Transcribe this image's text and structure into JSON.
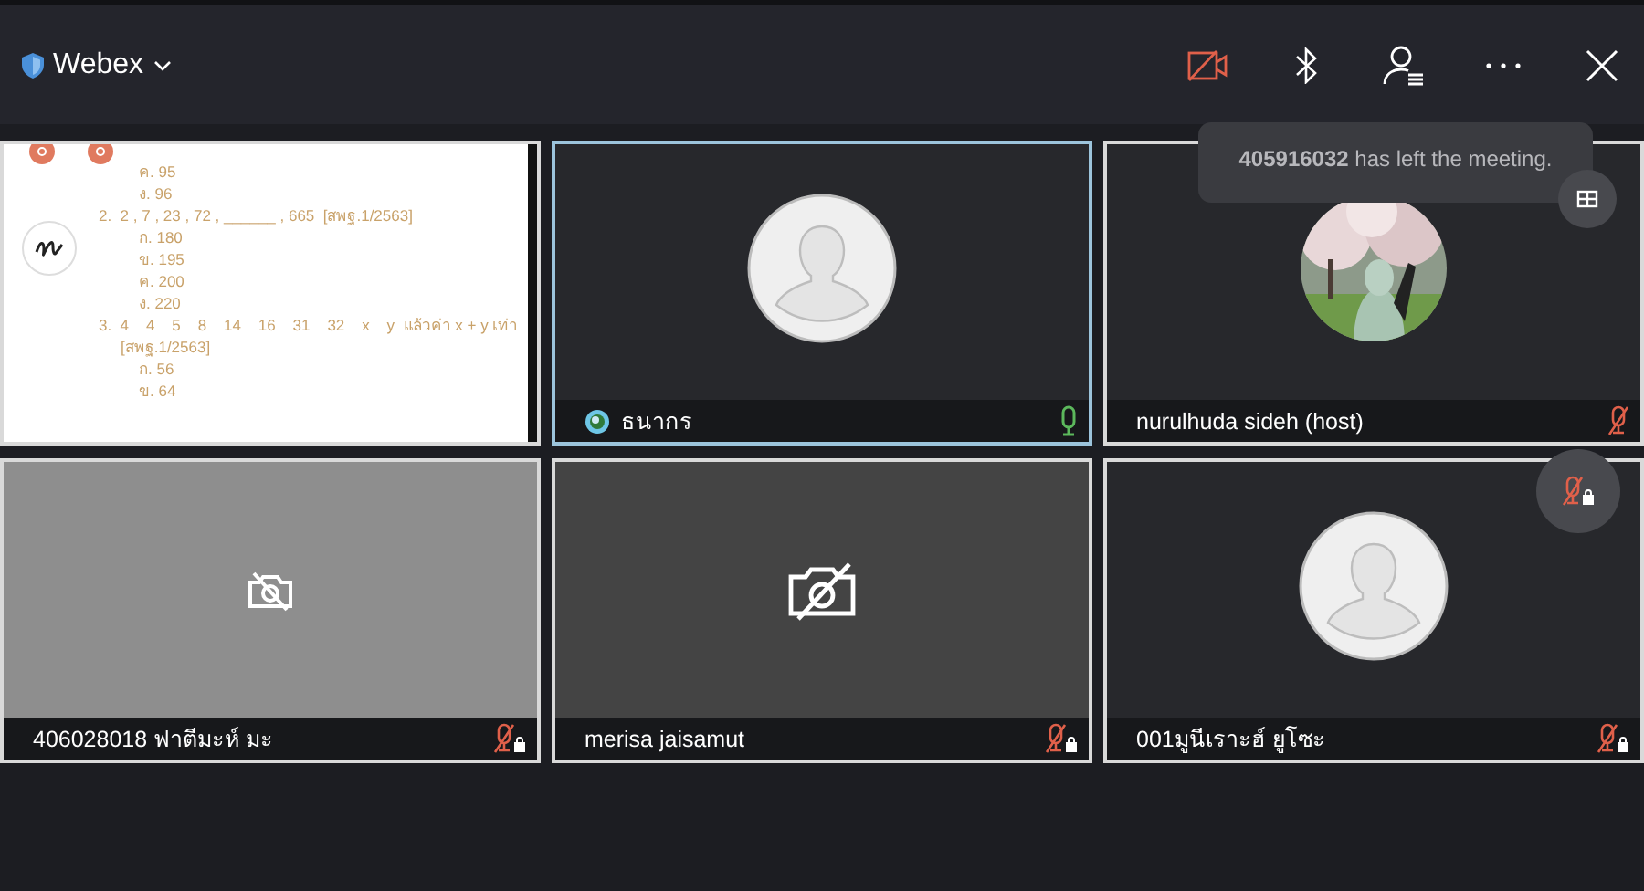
{
  "top_bar": {
    "app_name": "Webex",
    "camera_muted": true
  },
  "notification": {
    "text": "**405916032** has left the meeting."
  },
  "shared_content": {
    "lines": [
      {
        "kind": "option",
        "text": "ค. 95"
      },
      {
        "kind": "option",
        "text": "ง. 96"
      },
      {
        "kind": "question",
        "text": "2.  2 , 7 , 23 , 72 , ______ , 665  [สพฐ.1/2563]"
      },
      {
        "kind": "option",
        "text": "ก. 180"
      },
      {
        "kind": "option",
        "text": "ข. 195"
      },
      {
        "kind": "option",
        "text": "ค. 200"
      },
      {
        "kind": "option",
        "text": "ง. 220"
      },
      {
        "kind": "question",
        "text": "3.  4    4    5    8    14    16    31    32    x    y  แล้วค่า x + y เท่า"
      },
      {
        "kind": "source",
        "text": "[สพฐ.1/2563]"
      },
      {
        "kind": "option",
        "text": "ก. 56"
      },
      {
        "kind": "option",
        "text": "ข. 64"
      }
    ]
  },
  "tiles": [
    {
      "kind": "share",
      "selected": false
    },
    {
      "kind": "avatar",
      "name": "ธนากร",
      "muted": false,
      "locked": false,
      "selected": true,
      "status_dot": true
    },
    {
      "name": "nurulhuda sideh (host)",
      "muted": true,
      "locked": false,
      "selected": false,
      "status_dot": false
    },
    {
      "kind": "paused",
      "name": "406028018 ฟาตีมะห์ มะ",
      "muted": true,
      "locked": true,
      "selected": false,
      "status_dot": false
    },
    {
      "kind": "camera-off",
      "name": "merisa jaisamut",
      "muted": true,
      "locked": true,
      "selected": false,
      "status_dot": false
    },
    {
      "kind": "avatar",
      "name": "001มูนีเราะฮ์ ยูโซะ",
      "muted": true,
      "locked": true,
      "selected": false,
      "status_dot": false
    }
  ]
}
